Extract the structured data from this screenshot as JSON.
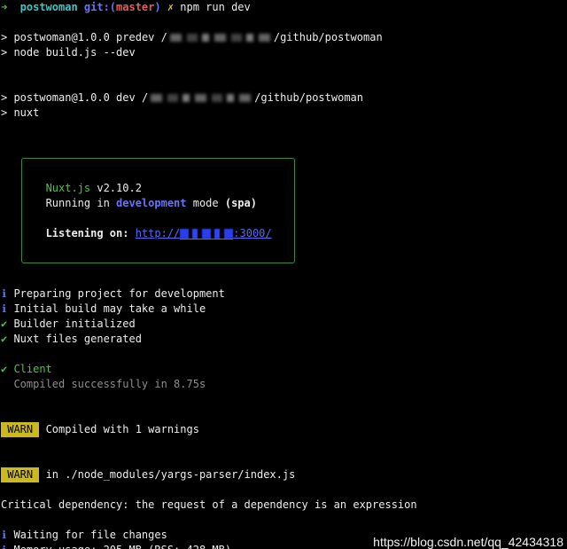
{
  "colors": {
    "background": "#000000",
    "text": "#ececec",
    "muted": "#8e8e8e",
    "green": "#4ec24e",
    "cyan": "#43c4c4",
    "blue": "#6a72f7",
    "red": "#e35d5d",
    "yellow": "#d6c64c",
    "info": "#5877f0",
    "link": "#5a66f4",
    "warn_bg": "#ccb91e",
    "warn_text": "#000000",
    "box_border": "#3b8a3b",
    "watermark": "#f2f2f2"
  },
  "prompt": {
    "arrow_icon": "arrow-right-icon",
    "arrow": "➜",
    "directory": "postwoman",
    "git_open": "git:(",
    "branch": "master",
    "git_close": ")",
    "dirty_icon": "ballot-x-icon",
    "dirty": "✗",
    "command": "npm run dev"
  },
  "scripts": [
    {
      "header_prefix": "> postwoman@1.0.0 predev /",
      "header_suffix": "/github/postwoman",
      "command": "> node build.js --dev"
    },
    {
      "header_prefix": "> postwoman@1.0.0 dev /",
      "header_suffix": "/github/postwoman",
      "command": "> nuxt"
    }
  ],
  "banner": {
    "name": "Nuxt.js",
    "version": "v2.10.2",
    "running": "Running in",
    "mode": "development",
    "mode_label": "mode",
    "target": "(spa)",
    "listening_label": "Listening on:",
    "url_prefix": "http://",
    "url_suffix": ":3000/"
  },
  "build_log": [
    {
      "icon": "info-icon",
      "glyph": "ℹ",
      "text": "Preparing project for development"
    },
    {
      "icon": "info-icon",
      "glyph": "ℹ",
      "text": "Initial build may take a while"
    },
    {
      "icon": "check-icon",
      "glyph": "✔",
      "text": "Builder initialized"
    },
    {
      "icon": "check-icon",
      "glyph": "✔",
      "text": "Nuxt files generated"
    }
  ],
  "client": {
    "icon": "check-icon",
    "glyph": "✔",
    "label": "Client",
    "status": "Compiled successfully in 8.75s"
  },
  "warnings": [
    {
      "badge": "WARN",
      "text": "Compiled with 1 warnings"
    },
    {
      "badge": "WARN",
      "text": "in ./node_modules/yargs-parser/index.js"
    }
  ],
  "critical_message": "Critical dependency: the request of a dependency is an expression",
  "watch_log": [
    {
      "icon": "info-icon",
      "glyph": "ℹ",
      "text": "Waiting for file changes"
    },
    {
      "icon": "info-icon",
      "glyph": "ℹ",
      "text": "Memory usage: 205 MB (RSS: 428 MB)"
    }
  ],
  "watermark": "https://blog.csdn.net/qq_42434318"
}
